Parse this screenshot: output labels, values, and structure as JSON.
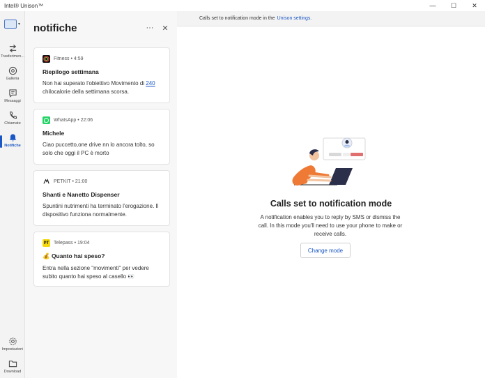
{
  "window": {
    "title": "Intel® Unison™",
    "controls": {
      "minimize": "—",
      "maximize": "☐",
      "close": "✕"
    }
  },
  "nav": {
    "items": [
      {
        "label": "Trasferimen...",
        "icon": "transfer-icon"
      },
      {
        "label": "Galleria",
        "icon": "gallery-icon"
      },
      {
        "label": "Messaggi",
        "icon": "message-icon"
      },
      {
        "label": "Chiamate",
        "icon": "phone-icon"
      },
      {
        "label": "Notifiche",
        "icon": "bell-icon",
        "active": true
      }
    ],
    "bottom": [
      {
        "label": "Impostazioni",
        "icon": "gear-icon"
      },
      {
        "label": "Download",
        "icon": "folder-icon"
      }
    ]
  },
  "panel": {
    "title": "notifiche",
    "more": "···",
    "close": "✕"
  },
  "notifications": [
    {
      "app": "Fitness",
      "time": "4:59",
      "title": "Riepilogo settimana",
      "body_pre": "Non hai superato l'obiettivo Movimento di ",
      "body_link": "240",
      "body_post": " chilocalorie della settimana scorsa."
    },
    {
      "app": "WhatsApp",
      "time": "22:06",
      "title": "Michele",
      "body": "Ciao puccetto,one drive nn lo ancora tolto, so solo che oggi il PC è  morto"
    },
    {
      "app": "PETKIT",
      "time": "21:00",
      "title": "Shanti e Nanetto Dispenser",
      "body": "Spuntini nutrimenti ha terminato l'erogazione. Il dispositivo funziona normalmente."
    },
    {
      "app": "Telepass",
      "time": "19:04",
      "title": "💰 Quanto hai speso?",
      "body": "Entra nella sezione \"movimenti\" per vedere subito quanto hai speso al casello 👀"
    }
  ],
  "main": {
    "info_text": "Calls set to notification mode in the",
    "info_link": "Unison settings.",
    "empty_title": "Calls set to notification mode",
    "empty_desc": "A notification enables you to reply by SMS or dismiss the call. In this mode you'll need to use your phone to make or receive calls.",
    "button": "Change mode"
  },
  "colors": {
    "accent": "#1a56c4",
    "fitness": "#2e7d32",
    "whatsapp": "#25d366",
    "telepass": "#f5d90a",
    "illustration_orange": "#ee7a35"
  }
}
